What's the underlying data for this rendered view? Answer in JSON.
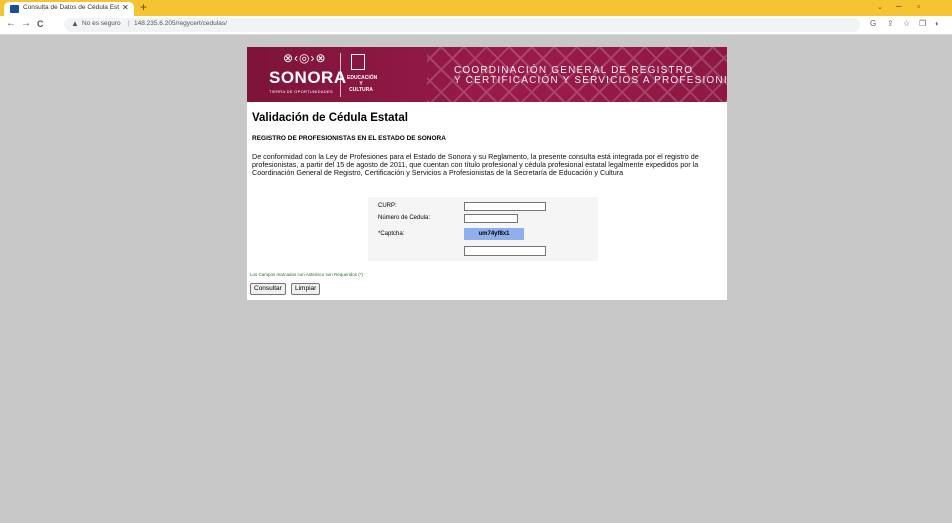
{
  "browser": {
    "tab_title": "Consulta de Datos de Cédula Est",
    "tab_close": "✕",
    "new_tab": "+",
    "nav_back": "←",
    "nav_forward": "→",
    "nav_reload": "C",
    "security_warning": "No es seguro",
    "url_separator": "|",
    "url": "148.235.6.205/regycert/cedulas/",
    "window_controls": [
      "⌄",
      "–",
      "▫"
    ],
    "toolbar_icons": [
      "G",
      "⇪",
      "☆",
      "❐",
      "◐"
    ]
  },
  "banner": {
    "glyphs": "⊗‹◎›⊗",
    "logo_text": "SONORA",
    "logo_tagline": "TIERRA DE OPORTUNIDADES",
    "secretaria_label": "EDUCACIÓN Y CULTURA",
    "coordination_line1": "COORDINACIÓN GENERAL DE REGISTRO",
    "coordination_line2": "Y CERTIFICACIÓN Y SERVICIOS A PROFESIONISTAS",
    "colors": {
      "primary": "#8e1845",
      "text": "#ffffff"
    }
  },
  "page": {
    "title": "Validación de Cédula Estatal",
    "section_heading": "REGISTRO DE PROFESIONISTAS EN EL ESTADO DE SONORA",
    "intro": "De conformidad con la Ley de Profesiones para el Estado de Sonora y su Reglamento, la presente consulta está integrada por el registro de profesionistas, a partir del 15 de agosto de 2011, que cuentan con título profesional y cédula profesional estatal legalmente expedidos por la Coordinación General de Registro, Certificación y Servicios a Profesionistas de la Secretaría de Educación y Cultura"
  },
  "form": {
    "curp_label": "CURP:",
    "curp_value": "",
    "cedula_label": "Número de Cedula:",
    "cedula_value": "",
    "captcha_label": "*Captcha:",
    "captcha_text": "um74yf8x1",
    "captcha_value": "",
    "required_note": "Los Campos marcados con Asterisco son Requeridos (*)",
    "consultar_label": "Consultar",
    "limpiar_label": "Limpiar"
  }
}
